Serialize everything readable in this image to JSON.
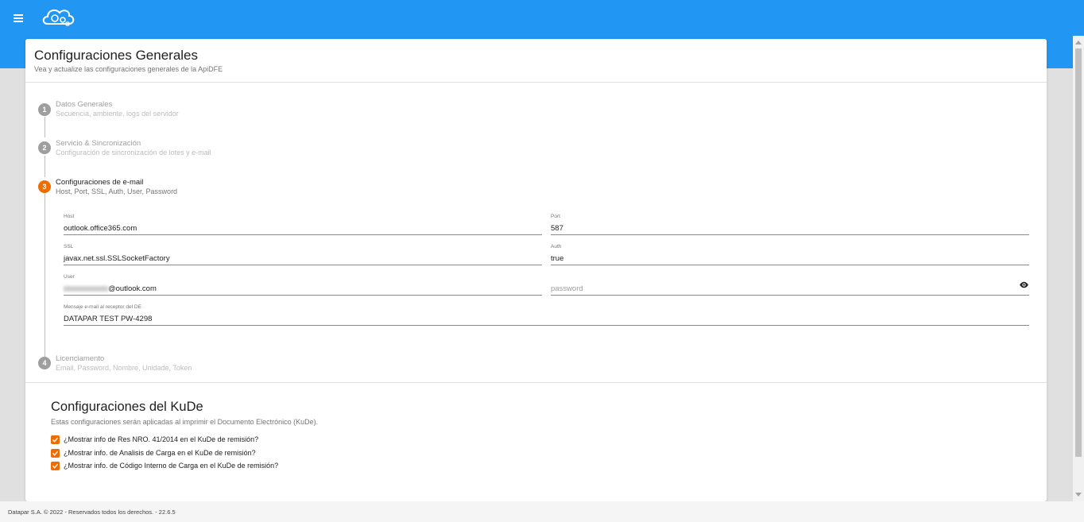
{
  "card": {
    "title": "Configuraciones Generales",
    "subtitle": "Vea y actualize las configuraciones generales de la ApiDFE"
  },
  "steps": [
    {
      "num": "1",
      "title": "Datos Generales",
      "desc": "Secuencia, ambiente, logs del servidor"
    },
    {
      "num": "2",
      "title": "Servicio & Sincronización",
      "desc": "Configuración de sincronización de lotes y e-mail"
    },
    {
      "num": "3",
      "title": "Configuraciones de e-mail",
      "desc": "Host, Port, SSL, Auth, User, Password"
    },
    {
      "num": "4",
      "title": "Licenciamento",
      "desc": "Email, Password, Nombre, Unidade, Token"
    }
  ],
  "email_form": {
    "host": {
      "label": "Host",
      "value": "outlook.office365.com"
    },
    "port": {
      "label": "Port",
      "value": "587"
    },
    "ssl": {
      "label": "SSL",
      "value": "javax.net.ssl.SSLSocketFactory"
    },
    "auth": {
      "label": "Auth",
      "value": "true"
    },
    "user": {
      "label": "User",
      "value_suffix": "@outlook.com"
    },
    "password": {
      "placeholder": "password"
    },
    "mensaje": {
      "label": "Mensaje e-mail al receptor del DE",
      "value": "DATAPAR TEST PW-4298"
    }
  },
  "kude": {
    "title": "Configuraciones del KuDe",
    "subtitle": "Estas configuraciones serán aplicadas al imprimir el Documento Electrónico (KuDe).",
    "options": [
      {
        "label": "¿Mostrar info de Res NRO. 41/2014 en el KuDe de remisión?",
        "checked": true
      },
      {
        "label": "¿Mostrar info. de Analisis de Carga en el KuDe de remisión?",
        "checked": true
      },
      {
        "label": "¿Mostrar info. de Código Interno de Carga en el KuDe de remisión?",
        "checked": true
      }
    ]
  },
  "footer": {
    "text": "Datapar S.A. © 2022 - Reservados todos los derechos. - 22.6.5"
  },
  "colors": {
    "primary": "#2196f3",
    "accent": "#ef6c00",
    "inactive_step": "#9e9e9e"
  }
}
